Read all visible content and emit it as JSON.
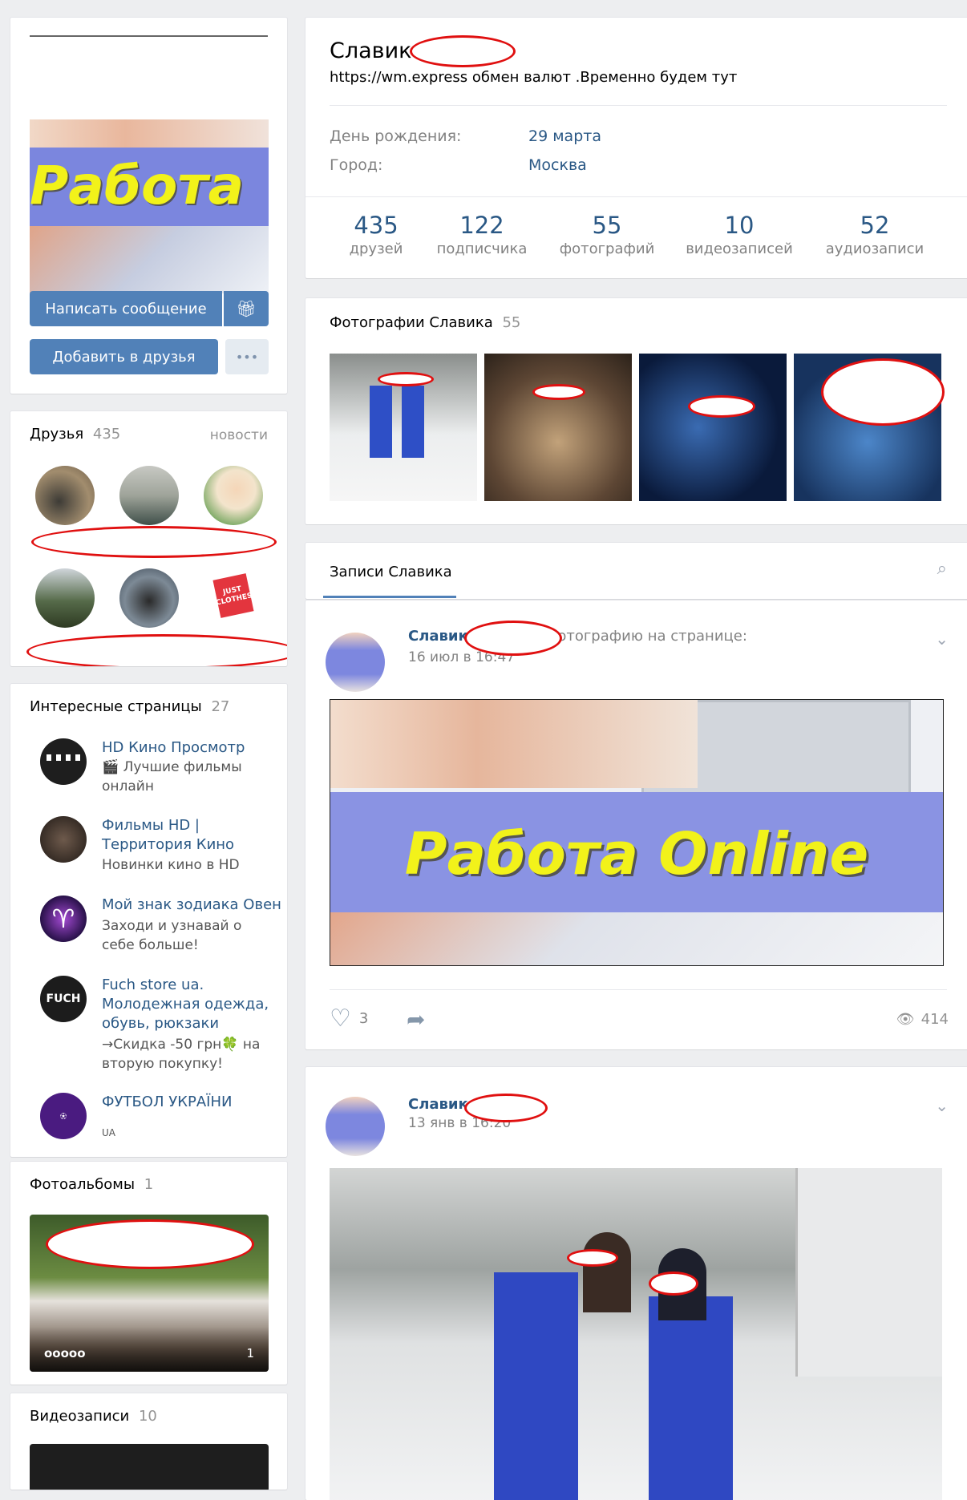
{
  "profile": {
    "name": "Славик",
    "status": "https://wm.express обмен валют .Временно будем тут",
    "birthday_label": "День рождения:",
    "birthday_value": "29 марта",
    "city_label": "Город:",
    "city_value": "Москва"
  },
  "counters": [
    {
      "num": "435",
      "label": "друзей"
    },
    {
      "num": "122",
      "label": "подписчика"
    },
    {
      "num": "55",
      "label": "фотографий"
    },
    {
      "num": "10",
      "label": "видеозаписей"
    },
    {
      "num": "52",
      "label": "аудиозаписи"
    }
  ],
  "left": {
    "avatar_caption": "Работа",
    "write_button": "Написать сообщение",
    "add_friend_button": "Добавить в друзья",
    "more_dots": "•••",
    "friends_title": "Друзья",
    "friends_count": "435",
    "friends_news": "новости",
    "friend6_logo": "JUST CLOTHES",
    "pages_title": "Интересные страницы",
    "pages_count": "27",
    "pages": [
      {
        "title": "HD Кино Просмотр",
        "sub": "🎬 Лучшие фильмы онлайн"
      },
      {
        "title": "Фильмы HD | Территория Кино",
        "sub": "Новинки кино в HD"
      },
      {
        "title": "Мой знак зодиака Овен",
        "sub": "Заходи и узнавай о себе больше!"
      },
      {
        "title": "Fuch store ua. Молодежная одежда, обувь, рюкзаки",
        "sub": "→Скидка -50 грн🍀 на вторую покупку!"
      },
      {
        "title": "ФУТБОЛ УКРАЇНИ",
        "sub": "UA"
      }
    ],
    "albums_title": "Фотоальбомы",
    "albums_count": "1",
    "album_name": "ооооо",
    "album_count": "1",
    "videos_title": "Видеозаписи",
    "videos_count": "10"
  },
  "photos": {
    "title": "Фотографии Славика",
    "count": "55"
  },
  "wall": {
    "tab_label": "Записи Славика",
    "post1": {
      "author": "Славик",
      "action": "обновил фотографию на странице:",
      "date": "16 июл в 16:47",
      "image_text": "Работа Online",
      "likes": "3",
      "views": "414"
    },
    "post2": {
      "author": "Славик",
      "date": "13 янв в 16:20"
    }
  },
  "colors": {
    "accent": "#5181b8",
    "link": "#2a5885",
    "background": "#edeef0",
    "redaction": "#e01010"
  },
  "icons": [
    "gift-icon",
    "more-icon",
    "search-icon",
    "chevron-down-icon",
    "heart-icon",
    "share-icon",
    "eye-icon"
  ]
}
